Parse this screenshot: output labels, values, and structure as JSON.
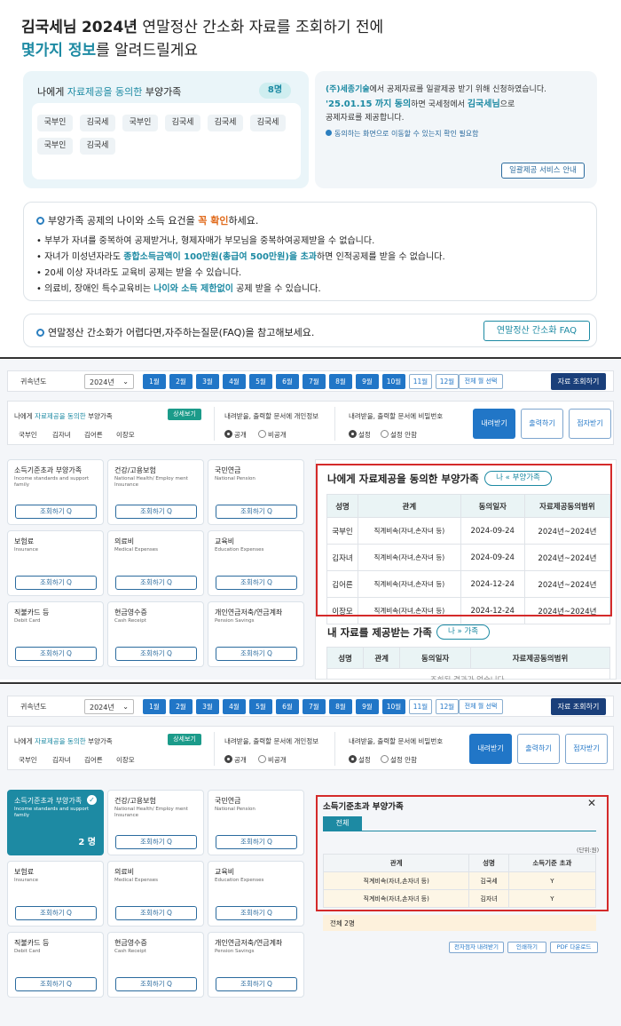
{
  "intro": {
    "heading_name": "김국세님",
    "heading_year": "2024년",
    "heading_rest": " 연말정산 간소화 자료를 조회하기 전에",
    "heading2_accent": "몇가지 정보",
    "heading2_rest": "를 알려드릴게요",
    "consent_title_pre": "나에게 ",
    "consent_title_accent": "자료제공을 동의한",
    "consent_title_post": " 부양가족",
    "consent_count": "8명",
    "consent_names": [
      "국부인",
      "김국세",
      "국부인",
      "김국세",
      "김국세",
      "김국세",
      "국부인",
      "김국세"
    ],
    "company_line1_accent": "(주)세종기술",
    "company_line1_rest": "에서 공제자료를 일괄제공 받기 위해 신청하였습니다.",
    "company_line2_date": "'25.01.15 까지 동의",
    "company_line2_mid": "하면 국세청에서 ",
    "company_line2_name": "김국세님",
    "company_line2_end": "으로",
    "company_line3": "공제자료를 제공합니다.",
    "company_note": "동의하는 화면으로 이동할 수 있는지 확인 필요함",
    "company_button": "일괄제공 서비스 안내",
    "notice_head_pre": "부양가족 공제의 나이와 소득 요건을 ",
    "notice_head_accent": "꼭 확인",
    "notice_head_post": "하세요.",
    "notice_1": "• 부부가 자녀를 중복하여 공제받거나, 형제자매가 부모님을 중복하여공제받을 수 없습니다.",
    "notice_2_pre": "• 자녀가 미성년자라도 ",
    "notice_2_accent": "종합소득금액이 100만원(총급여 500만원)을 초과",
    "notice_2_post": "하면 인적공제를 받을 수 없습니다.",
    "notice_3": "• 20세 이상 자녀라도 교육비 공제는 받을 수 있습니다.",
    "notice_4_pre": "• 의료비, 장애인 특수교육비는 ",
    "notice_4_accent": "나이와 소득 제한없이",
    "notice_4_post": " 공제 받을 수 있습니다.",
    "faq_text": "연말정산 간소화가 어렵다면,자주하는질문(FAQ)을 참고해보세요.",
    "faq_button": "연말정산 간소화 FAQ"
  },
  "toolbar": {
    "year_label": "귀속년도",
    "year_value": "2024년",
    "months": [
      "1월",
      "2월",
      "3월",
      "4월",
      "5월",
      "6월",
      "7월",
      "8월",
      "9월",
      "10월",
      "11월",
      "12월"
    ],
    "all_months": "전체 월 선택",
    "query_button": "자료 조회하기"
  },
  "consent": {
    "title_pre": "나에게 ",
    "title_accent": "자료제공을 동의한",
    "title_post": " 부양가족",
    "detail_button": "상세보기",
    "names": [
      "국부인",
      "김자녀",
      "김어른",
      "이장모"
    ],
    "privacy_label": "내려받을, 출력할 문서에 개인정보",
    "privacy_on": "공개",
    "privacy_off": "비공개",
    "password_label": "내려받을, 출력할 문서에 비밀번호",
    "password_on": "설정",
    "password_off": "설정 안함",
    "download_button": "내려받기",
    "print_button": "출력하기",
    "email_button": "점자받기"
  },
  "cards": [
    {
      "title": "소득기준초과 부양가족",
      "sub": "Income standards and support family",
      "action": "조회하기 Q"
    },
    {
      "title": "건강/고용보험",
      "sub": "National Health/ Employ ment Insurance",
      "action": "조회하기 Q"
    },
    {
      "title": "국민연금",
      "sub": "National Pension",
      "action": "조회하기 Q"
    },
    {
      "title": "보험료",
      "sub": "Insurance",
      "action": "조회하기 Q"
    },
    {
      "title": "의료비",
      "sub": "Medical Expenses",
      "action": "조회하기 Q"
    },
    {
      "title": "교육비",
      "sub": "Education Expenses",
      "action": "조회하기 Q"
    },
    {
      "title": "직불카드 등",
      "sub": "Debit Card",
      "action": "조회하기 Q"
    },
    {
      "title": "현금영수증",
      "sub": "Cash Receipt",
      "action": "조회하기 Q"
    },
    {
      "title": "개인연금저축/연금계좌",
      "sub": "Pension Savings",
      "action": "조회하기 Q"
    }
  ],
  "panel2": {
    "title": "나에게 자료제공을 동의한 부양가족",
    "tag": "나 « 부양가족",
    "headers": [
      "성명",
      "관계",
      "동의일자",
      "자료제공동의범위"
    ],
    "rows": [
      [
        "국부인",
        "직계비속(자녀,손자녀 등)",
        "2024-09-24",
        "2024년~2024년"
      ],
      [
        "김자녀",
        "직계비속(자녀,손자녀 등)",
        "2024-09-24",
        "2024년~2024년"
      ],
      [
        "김어른",
        "직계비속(자녀,손자녀 등)",
        "2024-12-24",
        "2024년~2024년"
      ],
      [
        "이장모",
        "직계비속(자녀,손자녀 등)",
        "2024-12-24",
        "2024년~2024년"
      ]
    ],
    "title2": "내 자료를 제공받는 가족",
    "tag2": "나 » 가족",
    "headers2": [
      "성명",
      "관계",
      "동의일자",
      "자료제공동의범위"
    ],
    "empty": "조회된 결과가 없습니다."
  },
  "panel3": {
    "selected_card_count": "2 명",
    "title": "소득기준초과 부양가족",
    "close": "✕",
    "tab": "전체",
    "unit": "(단위:원)",
    "headers": [
      "관계",
      "성명",
      "소득기준 초과"
    ],
    "rows": [
      [
        "직계비속(자녀,손자녀 등)",
        "김국세",
        "Y"
      ],
      [
        "직계비속(자녀,손자녀 등)",
        "김자녀",
        "Y"
      ]
    ],
    "total": "전체 2명",
    "btn_email": "전자점자 내려받기",
    "btn_print": "인쇄하기",
    "btn_pdf": "PDF 다운로드"
  }
}
